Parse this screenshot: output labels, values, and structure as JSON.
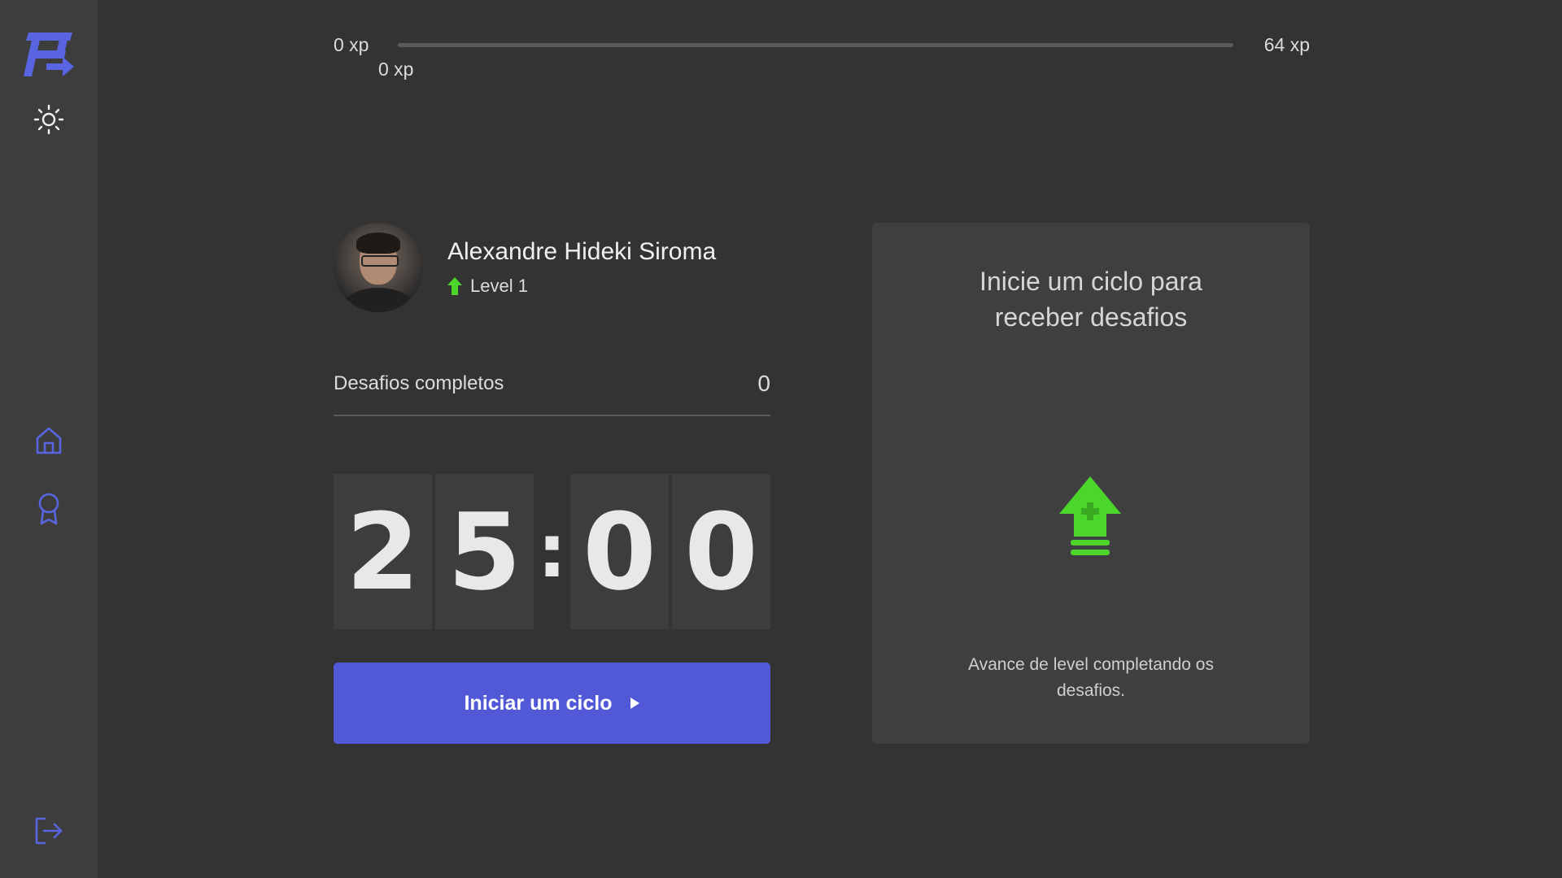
{
  "colors": {
    "background": "#333333",
    "sidebar": "#3d3d3d",
    "accent": "#5159d6",
    "level_green": "#4cd62b",
    "card": "#3f3f3f"
  },
  "sidebar": {
    "icons": [
      "logo-icon",
      "sun-icon",
      "home-icon",
      "award-icon",
      "logout-icon"
    ]
  },
  "xp": {
    "min_label": "0 xp",
    "max_label": "64 xp",
    "current_label": "0 xp",
    "progress": 0
  },
  "profile": {
    "name": "Alexandre Hideki Siroma",
    "level": "Level 1"
  },
  "stats": {
    "completed_label": "Desafios completos",
    "completed_count": "0"
  },
  "countdown": {
    "minute_tens": "2",
    "minute_ones": "5",
    "separator": ":",
    "second_tens": "0",
    "second_ones": "0"
  },
  "start_button": {
    "label": "Iniciar um ciclo"
  },
  "challenge_card": {
    "title_line1": "Inicie um ciclo para",
    "title_line2": "receber desafios",
    "description": "Avance de level completando os desafios."
  }
}
